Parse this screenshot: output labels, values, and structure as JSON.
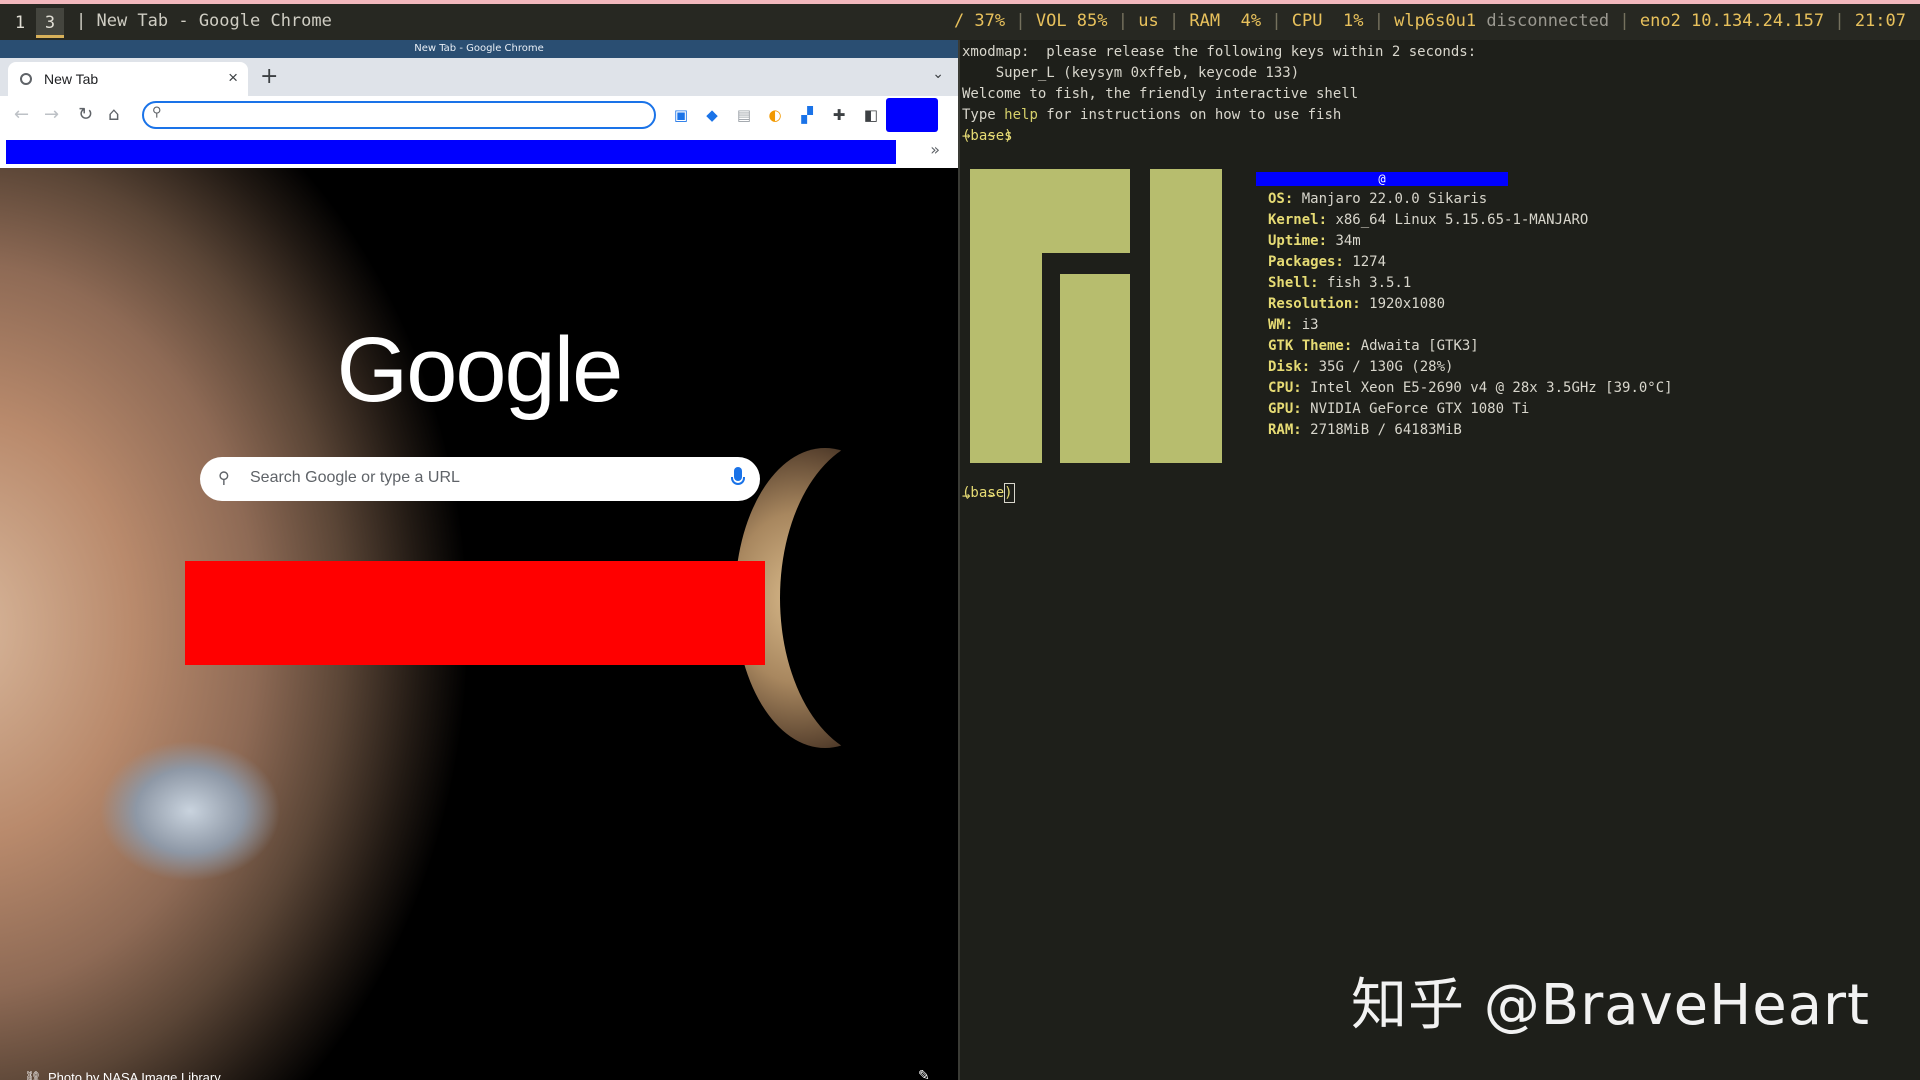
{
  "topbar": {
    "workspaces": [
      "1",
      "3"
    ],
    "title": "| New Tab - Google Chrome",
    "status": {
      "disk": "/ 37%",
      "volume": "VOL 85%",
      "layout": "us",
      "ram": "RAM  4%",
      "cpu": "CPU  1%",
      "wifi_iface": "wlp6s0u1",
      "wifi_state": "disconnected",
      "eth": "eno2 10.134.24.157",
      "clock": "21:07"
    }
  },
  "chrome": {
    "window_title": "New Tab - Google Chrome",
    "tab_title": "New Tab",
    "tab_close": "×",
    "new_tab": "+",
    "tab_menu": "⌄",
    "nav": {
      "back": "←",
      "forward": "→",
      "reload": "↻",
      "home": "⌂"
    },
    "omnibox_icon": "⚲",
    "omnibox_value": "",
    "bookmarks_more": "»",
    "logo_text": "Google",
    "search_placeholder": "Search Google or type a URL",
    "search_icon": "⚲",
    "credit_icon": "⛓",
    "credit_text": "Photo by NASA Image Library",
    "customize_icon": "✎",
    "icons": [
      "reading-list-icon",
      "extension-blue-icon",
      "doc-icon",
      "refresh-circle-icon",
      "badge-extension-icon",
      "puzzle-icon",
      "sidepanel-icon"
    ]
  },
  "terminal": {
    "lines": [
      "xmodmap:  please release the following keys within 2 seconds:",
      "    Super_L (keysym 0xffeb, keycode 133)",
      "Welcome to fish, the friendly interactive shell"
    ],
    "help_pre": "Type ",
    "help_word": "help",
    "help_post": " for instructions on how to use fish",
    "prompt1": "→  ~ s",
    "prompt2": "→  ~ ",
    "base_label": "(base)",
    "userhost_at": "@",
    "info": [
      {
        "key": "OS:",
        "val": " Manjaro 22.0.0 Sikaris"
      },
      {
        "key": "Kernel:",
        "val": " x86_64 Linux 5.15.65-1-MANJARO"
      },
      {
        "key": "Uptime:",
        "val": " 34m"
      },
      {
        "key": "Packages:",
        "val": " 1274"
      },
      {
        "key": "Shell:",
        "val": " fish 3.5.1"
      },
      {
        "key": "Resolution:",
        "val": " 1920x1080"
      },
      {
        "key": "WM:",
        "val": " i3"
      },
      {
        "key": "GTK Theme:",
        "val": " Adwaita [GTK3]"
      },
      {
        "key": "Disk:",
        "val": " 35G / 130G (28%)"
      },
      {
        "key": "CPU:",
        "val": " Intel Xeon E5-2690 v4 @ 28x 3.5GHz [39.0°C]"
      },
      {
        "key": "GPU:",
        "val": " NVIDIA GeForce GTX 1080 Ti"
      },
      {
        "key": "RAM:",
        "val": " 2718MiB / 64183MiB"
      }
    ]
  },
  "watermark": "知乎 @BraveHeart",
  "colors": {
    "redaction_blue": "#0000ff",
    "redaction_red": "#ff0000",
    "terminal_accent": "#e6db74",
    "manjaro_green": "#b7bd6e"
  }
}
